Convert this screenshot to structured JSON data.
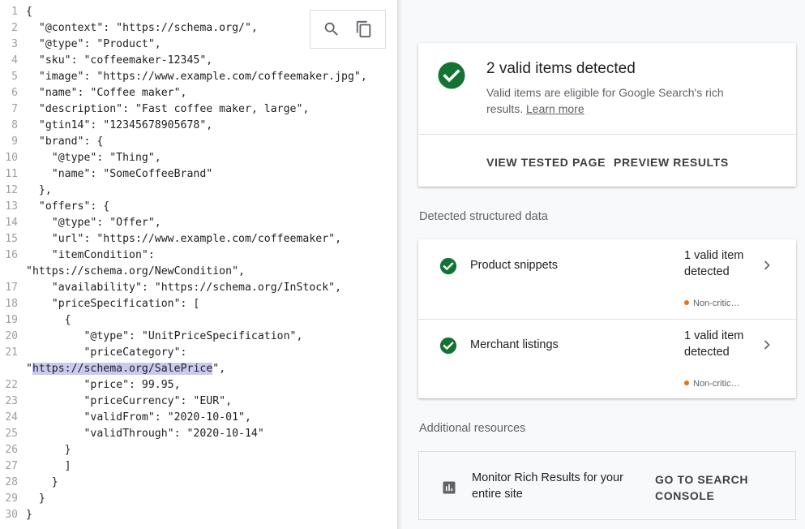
{
  "code": {
    "lines": [
      {
        "n": "1",
        "segments": [
          {
            "t": "{"
          }
        ]
      },
      {
        "n": "2",
        "segments": [
          {
            "t": "  \"@context\": \"https://schema.org/\","
          }
        ]
      },
      {
        "n": "3",
        "segments": [
          {
            "t": "  \"@type\": \"Product\","
          }
        ]
      },
      {
        "n": "4",
        "segments": [
          {
            "t": "  \"sku\": \"coffeemaker-12345\","
          }
        ]
      },
      {
        "n": "5",
        "segments": [
          {
            "t": "  \"image\": \"https://www.example.com/coffeemaker.jpg\","
          }
        ]
      },
      {
        "n": "6",
        "segments": [
          {
            "t": "  \"name\": \"Coffee maker\","
          }
        ]
      },
      {
        "n": "7",
        "segments": [
          {
            "t": "  \"description\": \"Fast coffee maker, large\","
          }
        ]
      },
      {
        "n": "8",
        "segments": [
          {
            "t": "  \"gtin14\": \"12345678905678\","
          }
        ]
      },
      {
        "n": "9",
        "segments": [
          {
            "t": "  \"brand\": {"
          }
        ]
      },
      {
        "n": "10",
        "segments": [
          {
            "t": "    \"@type\": \"Thing\","
          }
        ]
      },
      {
        "n": "11",
        "segments": [
          {
            "t": "    \"name\": \"SomeCoffeeBrand\""
          }
        ]
      },
      {
        "n": "12",
        "segments": [
          {
            "t": "  },"
          }
        ]
      },
      {
        "n": "13",
        "segments": [
          {
            "t": "  \"offers\": {"
          }
        ]
      },
      {
        "n": "14",
        "segments": [
          {
            "t": "    \"@type\": \"Offer\","
          }
        ]
      },
      {
        "n": "15",
        "segments": [
          {
            "t": "    \"url\": \"https://www.example.com/coffeemaker\","
          }
        ]
      },
      {
        "n": "16",
        "segments": [
          {
            "t": "    \"itemCondition\":"
          }
        ]
      },
      {
        "n": "",
        "segments": [
          {
            "t": "\"https://schema.org/NewCondition\","
          }
        ]
      },
      {
        "n": "17",
        "segments": [
          {
            "t": "    \"availability\": \"https://schema.org/InStock\","
          }
        ]
      },
      {
        "n": "18",
        "segments": [
          {
            "t": "    \"priceSpecification\": ["
          }
        ]
      },
      {
        "n": "19",
        "segments": [
          {
            "t": "      {"
          }
        ]
      },
      {
        "n": "20",
        "segments": [
          {
            "t": "         \"@type\": \"UnitPriceSpecification\","
          }
        ]
      },
      {
        "n": "21",
        "segments": [
          {
            "t": "         \"priceCategory\":"
          }
        ]
      },
      {
        "n": "",
        "segments": [
          {
            "t": "\""
          },
          {
            "t": "https://schema.org/SalePrice",
            "hl": true
          },
          {
            "t": "\","
          }
        ]
      },
      {
        "n": "22",
        "segments": [
          {
            "t": "         \"price\": 99.95,"
          }
        ]
      },
      {
        "n": "23",
        "segments": [
          {
            "t": "         \"priceCurrency\": \"EUR\","
          }
        ]
      },
      {
        "n": "24",
        "segments": [
          {
            "t": "         \"validFrom\": \"2020-10-01\","
          }
        ]
      },
      {
        "n": "25",
        "segments": [
          {
            "t": "         \"validThrough\": \"2020-10-14\""
          }
        ]
      },
      {
        "n": "26",
        "segments": [
          {
            "t": "      }"
          }
        ]
      },
      {
        "n": "27",
        "segments": [
          {
            "t": "      ]"
          }
        ]
      },
      {
        "n": "28",
        "segments": [
          {
            "t": "    }"
          }
        ]
      },
      {
        "n": "29",
        "segments": [
          {
            "t": "  }"
          }
        ]
      },
      {
        "n": "30",
        "segments": [
          {
            "t": "}"
          }
        ]
      }
    ],
    "toolbar": {
      "search_icon": "search-icon",
      "copy_icon": "copy-icon"
    }
  },
  "summary": {
    "title": "2 valid items detected",
    "desc_prefix": "Valid items are eligible for Google Search's rich results. ",
    "learn_more": "Learn more",
    "view_tested_page": "VIEW TESTED PAGE",
    "preview_results": "PREVIEW RESULTS",
    "check_color": "#137333"
  },
  "detected": {
    "heading": "Detected structured data",
    "items": [
      {
        "name": "Product snippets",
        "status": "1 valid item detected",
        "warning": "Non-critic…"
      },
      {
        "name": "Merchant listings",
        "status": "1 valid item detected",
        "warning": "Non-critic…"
      }
    ]
  },
  "additional": {
    "heading": "Additional resources",
    "monitor_text": "Monitor Rich Results for your entire site",
    "go_search_console": "GO TO SEARCH CONSOLE",
    "icon": "bar-chart-icon"
  }
}
